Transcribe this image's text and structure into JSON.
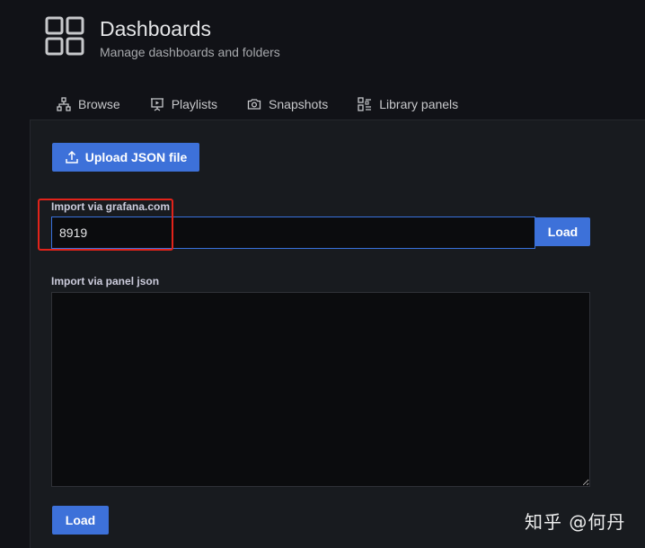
{
  "header": {
    "title": "Dashboards",
    "subtitle": "Manage dashboards and folders",
    "icon": "apps-grid-icon"
  },
  "tabs": [
    {
      "label": "Browse",
      "icon": "sitemap-icon"
    },
    {
      "label": "Playlists",
      "icon": "presentation-play-icon"
    },
    {
      "label": "Snapshots",
      "icon": "camera-icon"
    },
    {
      "label": "Library panels",
      "icon": "library-panel-icon"
    }
  ],
  "upload": {
    "label": "Upload JSON file",
    "icon": "upload-icon"
  },
  "grafana_import": {
    "label": "Import via grafana.com",
    "value": "8919",
    "load_label": "Load"
  },
  "panel_json": {
    "label": "Import via panel json",
    "value": "",
    "load_label": "Load"
  },
  "watermark": "知乎 @何丹",
  "colors": {
    "background": "#111217",
    "panel": "#181b1f",
    "primary": "#3d71d9",
    "highlight": "#e2231a"
  }
}
